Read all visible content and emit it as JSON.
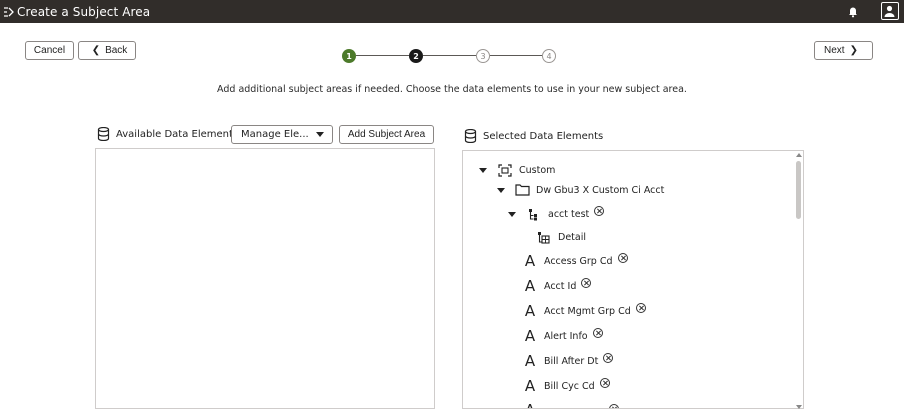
{
  "window": {
    "title": "Create a Subject Area"
  },
  "toolbar": {
    "cancel_label": "Cancel",
    "back_label": "Back",
    "next_label": "Next"
  },
  "train": {
    "steps": [
      {
        "label": "1",
        "state": "done"
      },
      {
        "label": "2",
        "state": "current"
      },
      {
        "label": "3",
        "state": "future"
      },
      {
        "label": "4",
        "state": "future"
      }
    ]
  },
  "instruction": "Add additional subject areas if needed. Choose the data elements to use in your new subject area.",
  "available": {
    "header": "Available Data Elements",
    "manage_label": "Manage Ele...",
    "add_subject_area_label": "Add Subject Area"
  },
  "selected": {
    "header": "Selected Data Elements",
    "tree": {
      "custom": "Custom",
      "folder": "Dw Gbu3 X Custom Ci Acct",
      "table": "acct test",
      "detail": "Detail",
      "attributes": [
        "Access Grp Cd",
        "Acct Id",
        "Acct Mgmt Grp Cd",
        "Alert Info",
        "Bill After Dt",
        "Bill Cyc Cd"
      ]
    }
  },
  "icons": {
    "app": "subject-area-icon",
    "notifications": "bell-icon",
    "user": "user-icon",
    "database": "database-icon",
    "attribute_glyph": "A"
  },
  "colors": {
    "titlebar": "#312d2a",
    "step_done": "#4c7a2a",
    "step_current": "#1a1a1a"
  }
}
